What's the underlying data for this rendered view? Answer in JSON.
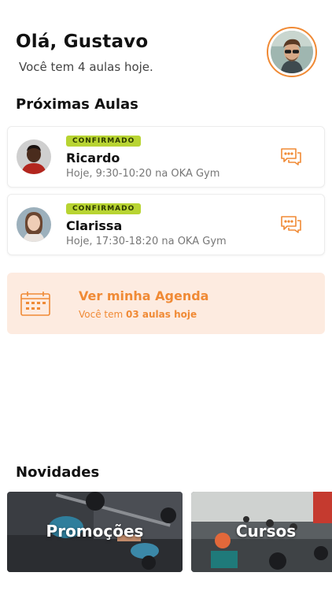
{
  "header": {
    "greeting": "Olá, Gustavo",
    "subtitle": "Você tem 4 aulas hoje."
  },
  "sections": {
    "next_classes": "Próximas Aulas",
    "news": "Novidades"
  },
  "classes": [
    {
      "badge": "CONFIRMADO",
      "name": "Ricardo",
      "meta": "Hoje, 9:30-10:20 na OKA Gym"
    },
    {
      "badge": "CONFIRMADO",
      "name": "Clarissa",
      "meta": "Hoje, 17:30-18:20 na OKA Gym"
    }
  ],
  "agenda": {
    "title": "Ver minha Agenda",
    "sub_prefix": "Você tem ",
    "sub_bold": "03 aulas hoje"
  },
  "news_cards": [
    {
      "label": "Promoções"
    },
    {
      "label": "Cursos"
    }
  ],
  "colors": {
    "accent": "#f08a35",
    "badge": "#b8d432",
    "agenda_bg": "#fdebe0"
  }
}
